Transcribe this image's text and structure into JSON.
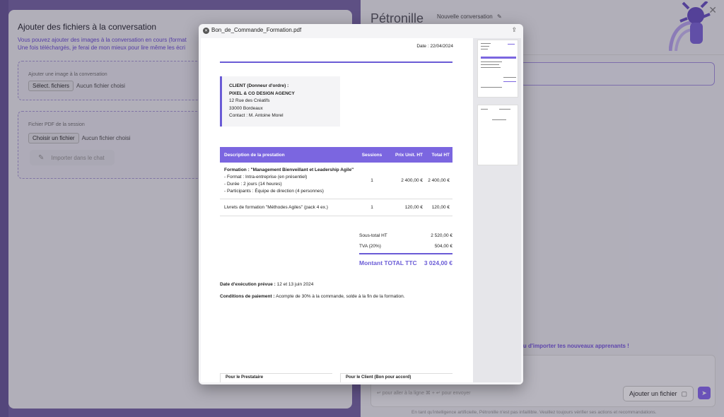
{
  "left_panel": {
    "title": "Ajouter des fichiers à la conversation",
    "desc_line1": "Vous pouvez ajouter des images à la conversation en cours (format",
    "desc_line2": "Une fois téléchargés, je ferai de mon mieux pour lire même les écri",
    "image_section_label": "Ajouter une image à la conversation",
    "image_button": "Sélect. fichiers",
    "image_status": "Aucun fichier choisi",
    "pdf_section_label": "Fichier PDF de la session",
    "pdf_button": "Choisir un fichier",
    "pdf_status": "Aucun fichier choisi",
    "import_button": "Importer dans le chat"
  },
  "right_panel": {
    "bot_name": "Pétronille",
    "conversation_label": "Nouvelle conversation",
    "hint": "ou d'importer tes nouveaux apprenants !",
    "kbd_hints": "↵ pour aller à la ligne   ⌘ + ↵ pour envoyer",
    "add_file_button": "Ajouter un fichier",
    "disclaimer": "En tant qu'intelligence artificielle, Pétronille n'est pas infaillible. Veuillez toujours vérifier ses actions et recommandations."
  },
  "modal": {
    "filename": "Bon_de_Commande_Formation.pdf"
  },
  "document": {
    "date": "Date : 22/04/2024",
    "client": {
      "heading": "CLIENT (Donneur d'ordre) :",
      "company": "PIXEL & CO DESIGN AGENCY",
      "address1": "12 Rue des Créatifs",
      "address2": "33000 Bordeaux",
      "contact": "Contact : M. Antoine Morel"
    },
    "table": {
      "headers": [
        "Description de la prestation",
        "Sessions",
        "Prix Unit. HT",
        "Total HT"
      ],
      "row1": {
        "title": "Formation : \"Management Bienveillant et Leadership Agile\"",
        "detail1": "- Format : Intra-entreprise (en présentiel)",
        "detail2": "- Durée : 2 jours (14 heures)",
        "detail3": "- Participants : Équipe de direction (4 personnes)",
        "sessions": "1",
        "unit": "2 400,00 €",
        "total": "2 400,00 €"
      },
      "row2": {
        "title": "Livrets de formation \"Méthodes Agiles\" (pack 4 ex.)",
        "sessions": "1",
        "unit": "120,00 €",
        "total": "120,00 €"
      }
    },
    "subtotal_label": "Sous-total HT",
    "subtotal_value": "2 520,00 €",
    "vat_label": "TVA (20%)",
    "vat_value": "504,00 €",
    "grand_label": "Montant TOTAL TTC",
    "grand_value": "3 024,00 €",
    "exec_label": "Date d'exécution prévue :",
    "exec_value": "12 et 13 juin 2024",
    "cond_label": "Conditions de paiement :",
    "cond_value": "Acompte de 30% à la commande, solde à la fin de la formation.",
    "sig_provider": "Pour le Prestataire",
    "sig_client": "Pour le Client (Bon pour accord)"
  }
}
